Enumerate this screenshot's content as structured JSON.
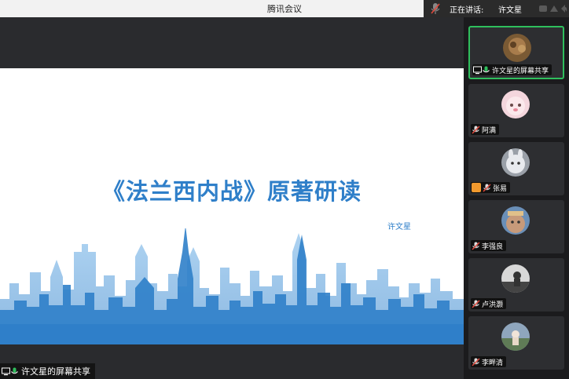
{
  "window": {
    "title": "腾讯会议",
    "speaking_label": "正在讲话:",
    "speaking_name": "许文星"
  },
  "main": {
    "slide_title": "《法兰西内战》原著研读",
    "slide_author": "许文星",
    "share_label": "许文星的屏幕共享"
  },
  "participants": [
    {
      "label": "许文星的屏幕共享",
      "active": true
    },
    {
      "label": "阿满"
    },
    {
      "label": "张易"
    },
    {
      "label": "李强良"
    },
    {
      "label": "卢洪灏"
    },
    {
      "label": "李畔清"
    }
  ],
  "colors": {
    "accent": "#2f7fc9",
    "active_border": "#2fbf5d",
    "mic_muted": "#e0493d",
    "mic_on": "#2fbf5d"
  },
  "icons": {
    "screen_share": "screen-share-icon",
    "mic_on": "microphone-icon",
    "mic_muted": "microphone-muted-icon",
    "person": "person-icon"
  }
}
